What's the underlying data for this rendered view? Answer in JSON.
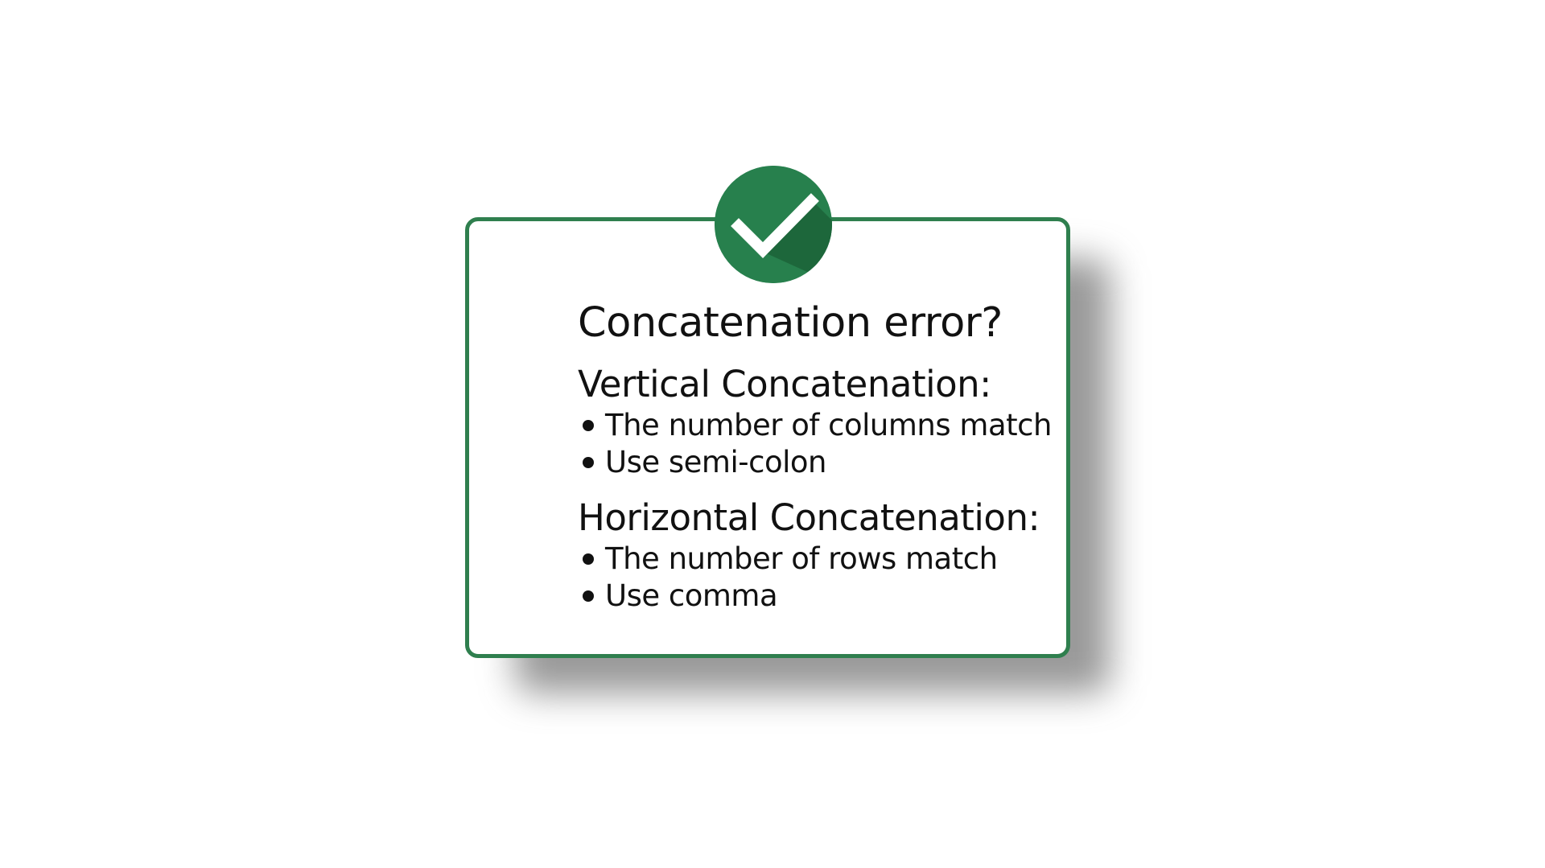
{
  "card": {
    "title": "Concatenation error?",
    "badge_icon": "checkmark-icon",
    "accent_color": "#2f7f4e",
    "sections": [
      {
        "heading": "Vertical Concatenation:",
        "bullets": [
          "The number of columns match",
          "Use semi-colon"
        ]
      },
      {
        "heading": "Horizontal Concatenation:",
        "bullets": [
          "The number of rows match",
          "Use comma"
        ]
      }
    ]
  }
}
